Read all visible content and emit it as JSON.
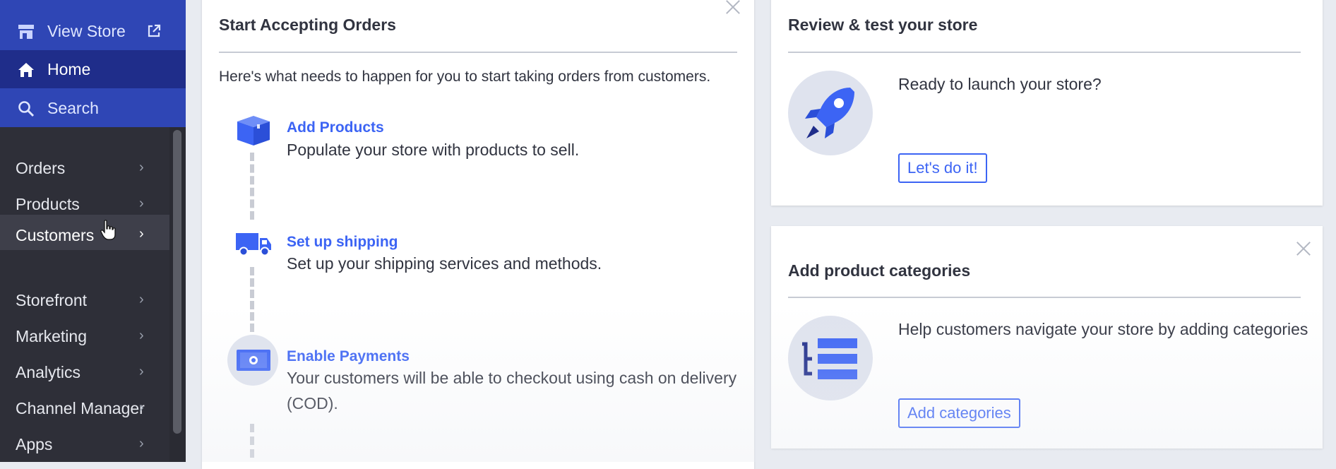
{
  "sidebar": {
    "top": {
      "view_store": "View Store",
      "home": "Home",
      "search": "Search"
    },
    "items": [
      {
        "label": "Orders"
      },
      {
        "label": "Products"
      },
      {
        "label": "Customers"
      },
      {
        "label": "Storefront"
      },
      {
        "label": "Marketing"
      },
      {
        "label": "Analytics"
      },
      {
        "label": "Channel Manager"
      },
      {
        "label": "Apps"
      }
    ],
    "active_item": "Customers"
  },
  "orders_card": {
    "title": "Start Accepting Orders",
    "intro": "Here's what needs to happen for you to start taking orders from customers.",
    "steps": [
      {
        "title": "Add Products",
        "desc": "Populate your store with products to sell.",
        "icon": "box-icon"
      },
      {
        "title": "Set up shipping",
        "desc": "Set up your shipping services and methods.",
        "icon": "truck-icon"
      },
      {
        "title": "Enable Payments",
        "desc_line1": "Your customers will be able to checkout using cash on delivery",
        "desc_line2": "(COD).",
        "icon": "cash-icon"
      }
    ]
  },
  "review_card": {
    "title": "Review & test your store",
    "text": "Ready to launch your store?",
    "button": "Let's do it!",
    "icon": "rocket-icon"
  },
  "categories_card": {
    "title": "Add product categories",
    "text": "Help customers navigate your store by adding categories",
    "button": "Add categories",
    "icon": "category-list-icon"
  },
  "colors": {
    "accent": "#3c64f4",
    "sidebar_bg": "#2e2f38",
    "top_nav_bg": "#2f46b5",
    "home_bg": "#1f2d8a"
  }
}
